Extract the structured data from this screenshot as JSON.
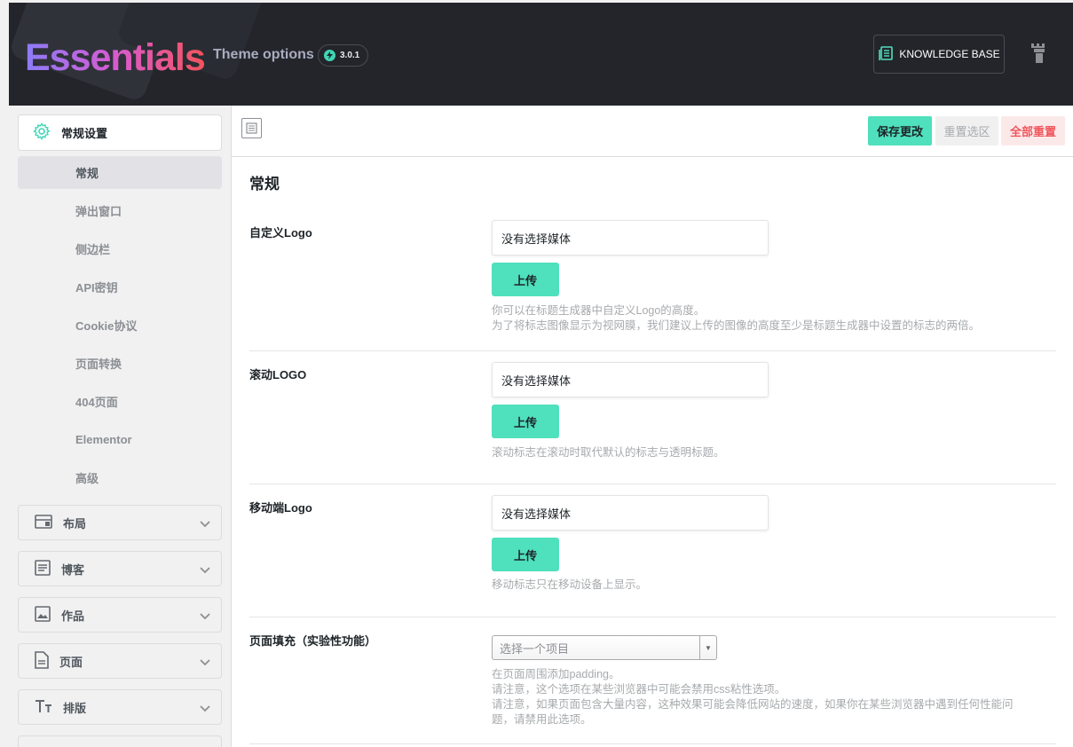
{
  "header": {
    "logo": "Essentials",
    "subtitle": "Theme options",
    "version": "3.0.1",
    "kb_button": "KNOWLEDGE BASE",
    "accent": "#4fe0bd"
  },
  "sidebar": {
    "active_section": "常规设置",
    "sub_items": [
      "常规",
      "弹出窗口",
      "侧边栏",
      "API密钥",
      "Cookie协议",
      "页面转换",
      "404页面",
      "Elementor",
      "高级"
    ],
    "current_sub_index": 0,
    "sections": [
      {
        "label": "布局",
        "icon": "layout-icon"
      },
      {
        "label": "博客",
        "icon": "blog-icon"
      },
      {
        "label": "作品",
        "icon": "portfolio-image-icon"
      },
      {
        "label": "页面",
        "icon": "page-icon"
      },
      {
        "label": "排版",
        "icon": "typography-icon"
      }
    ]
  },
  "toolbar": {
    "save": "保存更改",
    "reset_section": "重置选区",
    "reset_all": "全部重置"
  },
  "main": {
    "title": "常规",
    "rows": [
      {
        "label": "自定义Logo",
        "media": "没有选择媒体",
        "upload": "上传",
        "desc": [
          "你可以在标题生成器中自定义Logo的高度。",
          "为了将标志图像显示为视网膜，我们建议上传的图像的高度至少是标题生成器中设置的标志的两倍。"
        ]
      },
      {
        "label": "滚动LOGO",
        "media": "没有选择媒体",
        "upload": "上传",
        "desc": [
          "滚动标志在滚动时取代默认的标志与透明标题。"
        ]
      },
      {
        "label": "移动端Logo",
        "media": "没有选择媒体",
        "upload": "上传",
        "desc": [
          "移动标志只在移动设备上显示。"
        ]
      },
      {
        "label": "页面填充（实验性功能）",
        "select_placeholder": "选择一个项目",
        "desc": [
          "在页面周围添加padding。",
          "请注意，这个选项在某些浏览器中可能会禁用css粘性选项。",
          "请注意，如果页面包含大量内容，这种效果可能会降低网站的速度，如果你在某些浏览器中遇到任何性能问",
          "题，请禁用此选项。"
        ]
      }
    ]
  }
}
